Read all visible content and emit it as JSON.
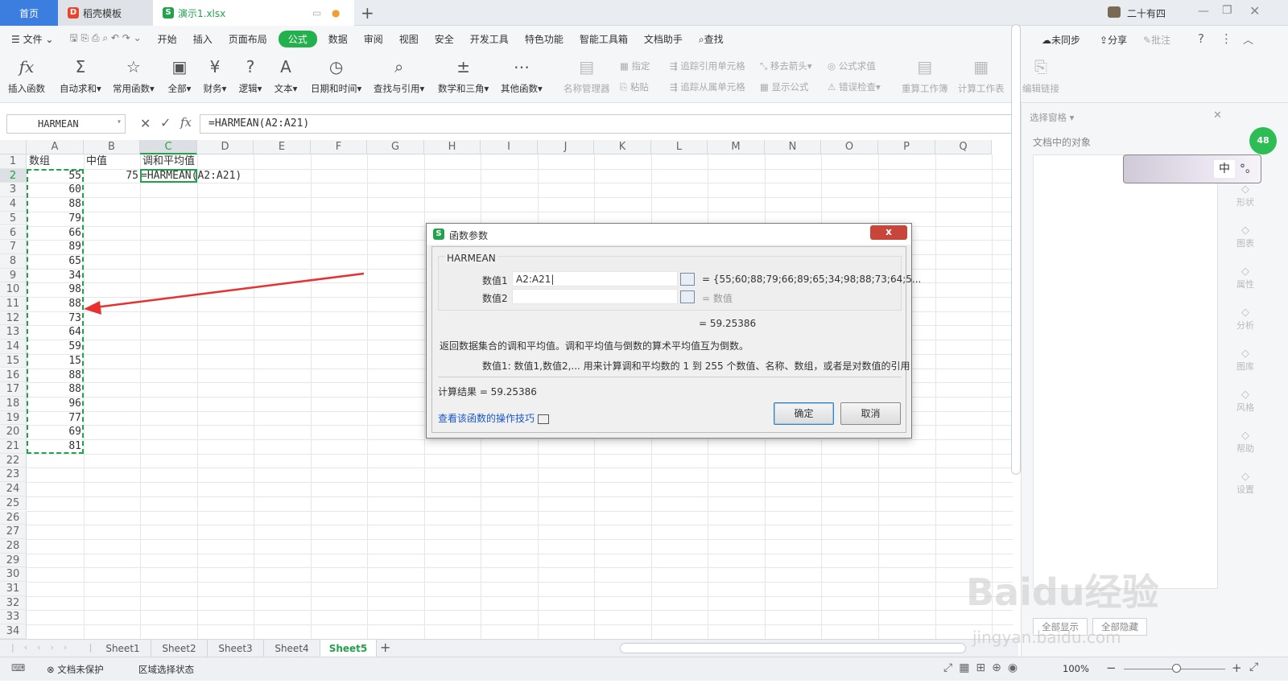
{
  "tabs": {
    "home": "首页",
    "template": "稻壳模板",
    "file": "演示1.xlsx",
    "user": "二十有四"
  },
  "menu": {
    "file": "文件",
    "items": [
      "开始",
      "插入",
      "页面布局",
      "公式",
      "数据",
      "审阅",
      "视图",
      "安全",
      "开发工具",
      "特色功能",
      "智能工具箱",
      "文档助手"
    ],
    "active": "公式",
    "search": "查找",
    "sync": "未同步",
    "share": "分享",
    "comment": "批注"
  },
  "ribbon": {
    "insert_fn": "插入函数",
    "autosum": "自动求和",
    "common": "常用函数",
    "all": "全部",
    "finance": "财务",
    "logic": "逻辑",
    "text": "文本",
    "datetime": "日期和时间",
    "lookup": "查找与引用",
    "math": "数学和三角",
    "other": "其他函数",
    "name_mgr": "名称管理器",
    "specify": "指定",
    "paste": "粘贴",
    "trace_prec": "追踪引用单元格",
    "trace_dep": "追踪从属单元格",
    "remove_arrows": "移去箭头",
    "show_formula": "显示公式",
    "eval": "公式求值",
    "err_check": "错误检查",
    "recalc": "重算工作簿",
    "calc_sheet": "计算工作表",
    "edit_links": "编辑链接"
  },
  "formula_bar": {
    "name_box": "HARMEAN",
    "formula": "=HARMEAN(A2:A21)",
    "fx": "fx"
  },
  "columns": [
    "A",
    "B",
    "C",
    "D",
    "E",
    "F",
    "G",
    "H",
    "I",
    "J",
    "K",
    "L",
    "M",
    "N",
    "O",
    "P",
    "Q"
  ],
  "rows": [
    "1",
    "2",
    "3",
    "4",
    "5",
    "6",
    "7",
    "8",
    "9",
    "10",
    "11",
    "12",
    "13",
    "14",
    "15",
    "16",
    "17",
    "18",
    "19",
    "20",
    "21",
    "22",
    "23",
    "24",
    "25",
    "26",
    "27",
    "28",
    "29",
    "30",
    "31",
    "32",
    "33",
    "34"
  ],
  "cells": {
    "A1": "数组",
    "B1": "中值",
    "C1": "调和平均值",
    "B2": "75",
    "C2": "=HARMEAN(A2:A21)",
    "A_values": [
      "55",
      "60",
      "88",
      "79",
      "66",
      "89",
      "65",
      "34",
      "98",
      "88",
      "73",
      "64",
      "59",
      "15",
      "88",
      "88",
      "96",
      "77",
      "69",
      "81"
    ]
  },
  "sheets": [
    "Sheet1",
    "Sheet2",
    "Sheet3",
    "Sheet4",
    "Sheet5"
  ],
  "active_sheet": "Sheet5",
  "status": {
    "protect": "文档未保护",
    "mode": "区域选择状态",
    "zoom": "100%"
  },
  "right_pane": {
    "title": "选择窗格",
    "objects": "文档中的对象",
    "show_all": "全部显示",
    "hide_all": "全部隐藏",
    "side": [
      "形状",
      "图表",
      "属性",
      "分析",
      "图库",
      "风格",
      "帮助",
      "设置"
    ],
    "badge": "48",
    "float_char": "中"
  },
  "dialog": {
    "title": "函数参数",
    "fn": "HARMEAN",
    "arg1_label": "数值1",
    "arg1_value": "A2:A21",
    "arg1_result": "= {55;60;88;79;66;89;65;34;98;88;73;64;5...",
    "arg2_label": "数值2",
    "arg2_result": "= 数值",
    "result_line": "= 59.25386",
    "desc": "返回数据集合的调和平均值。调和平均值与倒数的算术平均值互为倒数。",
    "arg_desc": "数值1:   数值1,数值2,... 用来计算调和平均数的 1 到 255 个数值、名称、数组，或者是对数值的引用",
    "calc_result": "计算结果  =  59.25386",
    "help_link": "查看该函数的操作技巧",
    "ok": "确定",
    "cancel": "取消",
    "close": "x"
  },
  "watermark": {
    "text": "Baidu经验",
    "url": "jingyan.baidu.com"
  }
}
